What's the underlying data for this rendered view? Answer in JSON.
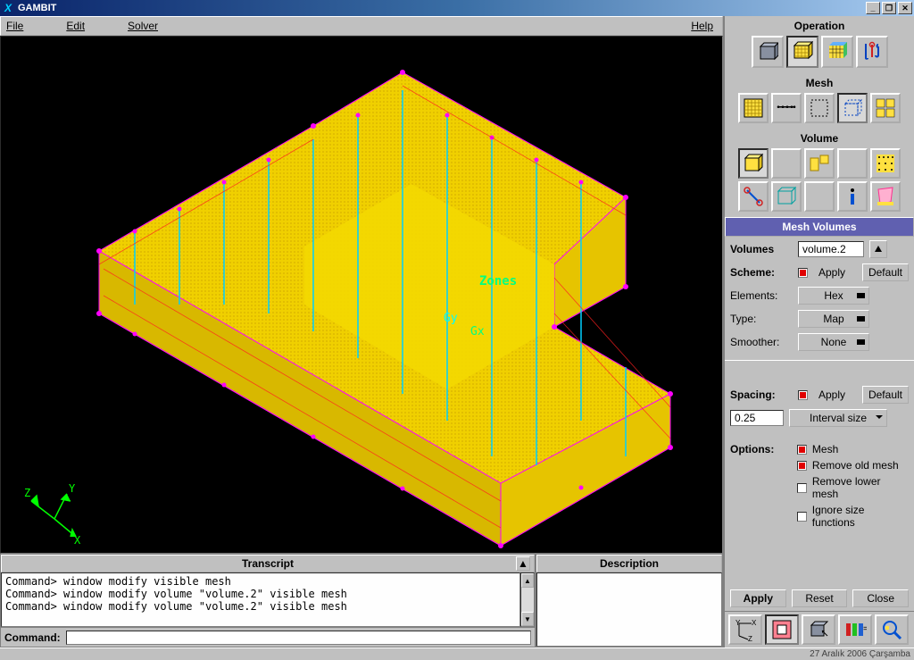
{
  "titlebar": {
    "app_icon_text": "X",
    "title": "GAMBIT"
  },
  "menubar": {
    "file": "File",
    "edit": "Edit",
    "solver": "Solver",
    "help": "Help"
  },
  "viewport": {
    "zones_label": "Zones",
    "center_label_gy": "Gy",
    "center_label_gx": "Gx",
    "axis_x": "X",
    "axis_y": "Y",
    "axis_z": "Z"
  },
  "bottom": {
    "transcript_title": "Transcript",
    "description_title": "Description",
    "transcript_lines": [
      "Command> window modify visible mesh",
      "Command> window modify volume \"volume.2\" visible mesh",
      "Command> window modify volume \"volume.2\" visible mesh"
    ],
    "command_label": "Command:",
    "command_value": ""
  },
  "right": {
    "operation_label": "Operation",
    "mesh_label": "Mesh",
    "volume_label": "Volume",
    "form_title": "Mesh Volumes",
    "volumes_label": "Volumes",
    "volumes_value": "volume.2",
    "scheme_label": "Scheme:",
    "scheme_apply": "Apply",
    "scheme_default": "Default",
    "elements_label": "Elements:",
    "elements_value": "Hex",
    "type_label": "Type:",
    "type_value": "Map",
    "smoother_label": "Smoother:",
    "smoother_value": "None",
    "spacing_label": "Spacing:",
    "spacing_apply": "Apply",
    "spacing_default": "Default",
    "spacing_value": "0.25",
    "spacing_mode": "Interval size",
    "options_label": "Options:",
    "opt_mesh": "Mesh",
    "opt_remove_old": "Remove old mesh",
    "opt_remove_lower": "Remove lower mesh",
    "opt_ignore_size": "Ignore size functions",
    "apply_btn": "Apply",
    "reset_btn": "Reset",
    "close_btn": "Close"
  },
  "taskbar": {
    "date": "27 Aralık 2006 Çarşamba"
  }
}
